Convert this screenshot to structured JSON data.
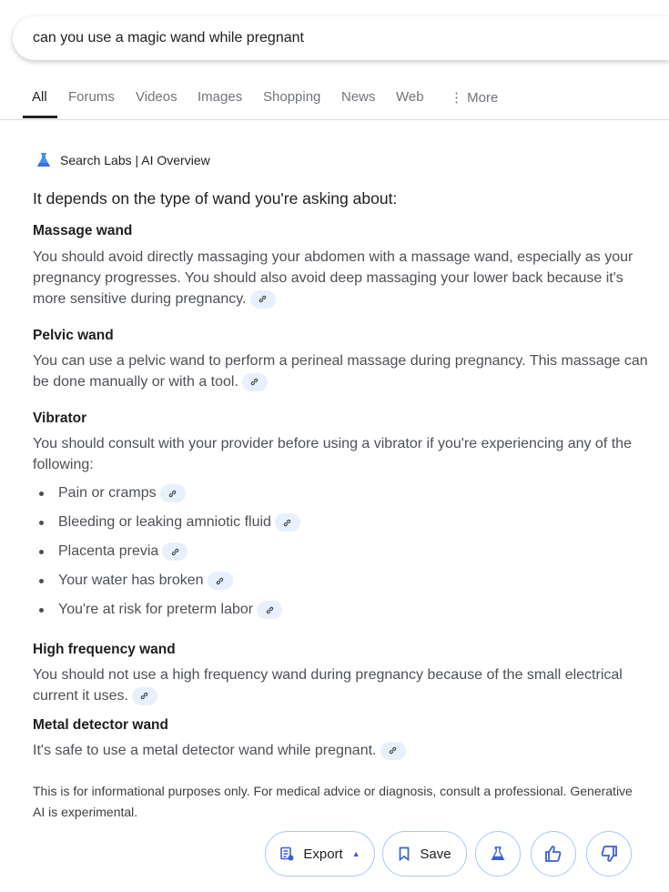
{
  "search": {
    "query": "can you use a magic wand while pregnant"
  },
  "tabs": [
    "All",
    "Forums",
    "Videos",
    "Images",
    "Shopping",
    "News",
    "Web",
    "More"
  ],
  "overview": {
    "label": "Search Labs | AI Overview",
    "lead": "It depends on the type of wand you're asking about:",
    "sections": [
      {
        "title": "Massage wand",
        "text": "You should avoid directly massaging your abdomen with a massage wand, especially as your pregnancy progresses. You should also avoid deep massaging your lower back because it's more sensitive during pregnancy."
      },
      {
        "title": "Pelvic wand",
        "text": "You can use a pelvic wand to perform a perineal massage during pregnancy. This massage can be done manually or with a tool."
      },
      {
        "title": "Vibrator",
        "text": "You should consult with your provider before using a vibrator if you're experiencing any of the following:",
        "bullets": [
          "Pain or cramps",
          "Bleeding or leaking amniotic fluid",
          "Placenta previa",
          "Your water has broken",
          "You're at risk for preterm labor"
        ]
      },
      {
        "title": "High frequency wand",
        "text": "You should not use a high frequency wand during pregnancy because of the small electrical current it uses."
      },
      {
        "title": "Metal detector wand",
        "text": "It's safe to use a metal detector wand while pregnant."
      }
    ],
    "disclaimer": "This is for informational purposes only. For medical advice or diagnosis, consult a professional. Generative AI is experimental."
  },
  "actions": {
    "export": "Export",
    "save": "Save"
  },
  "colors": {
    "accent": "#3b5fd9",
    "chip": "#e8f0fe",
    "border": "#a8c7fa"
  }
}
